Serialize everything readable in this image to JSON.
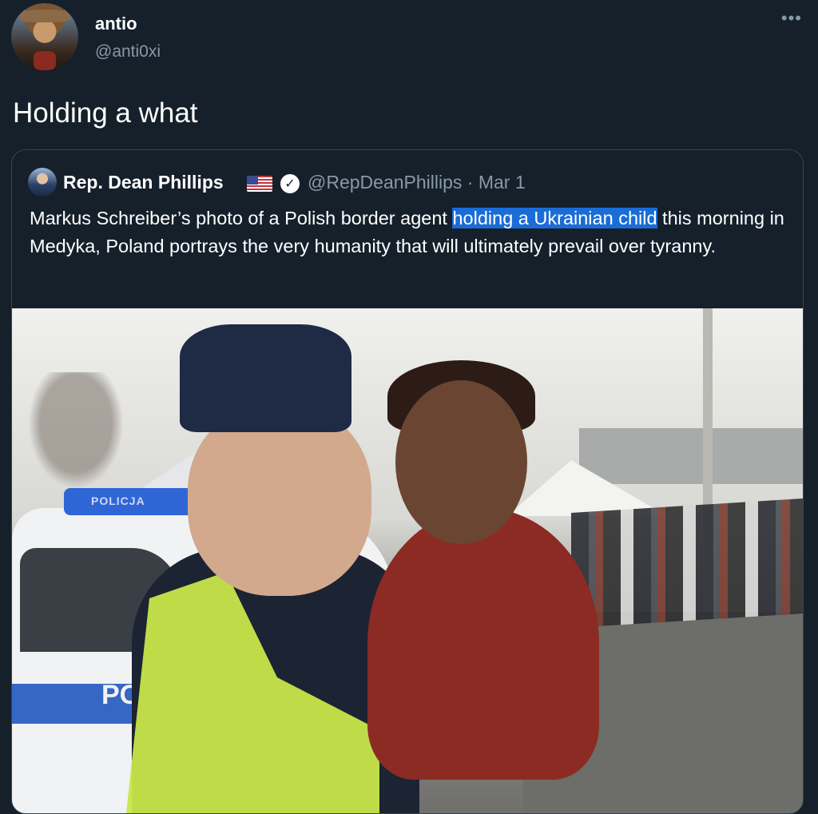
{
  "tweet": {
    "author_name": "antio",
    "author_handle": "@anti0xi",
    "more_label": "•••",
    "text": "Holding a what"
  },
  "quoted": {
    "author_name": "Rep. Dean Phillips",
    "verified_glyph": "✓",
    "handle_and_date": "@RepDeanPhillips · Mar 1",
    "text_before": "Markus Schreiber’s photo of a Polish border agent ",
    "text_highlight": "holding a Ukrainian child",
    "text_after": " this morning in Medyka, Poland portrays the very humanity that will ultimately prevail over tyranny.",
    "photo_signage": {
      "car_light_text": "POLICJA",
      "car_side_text": "PO"
    }
  },
  "icons": {
    "flag": "us-flag-icon",
    "verified": "verified-badge-icon",
    "more": "more-options-icon"
  },
  "colors": {
    "background": "#15202b",
    "secondary_text": "#8899a6",
    "highlight": "#1a6cd6"
  }
}
